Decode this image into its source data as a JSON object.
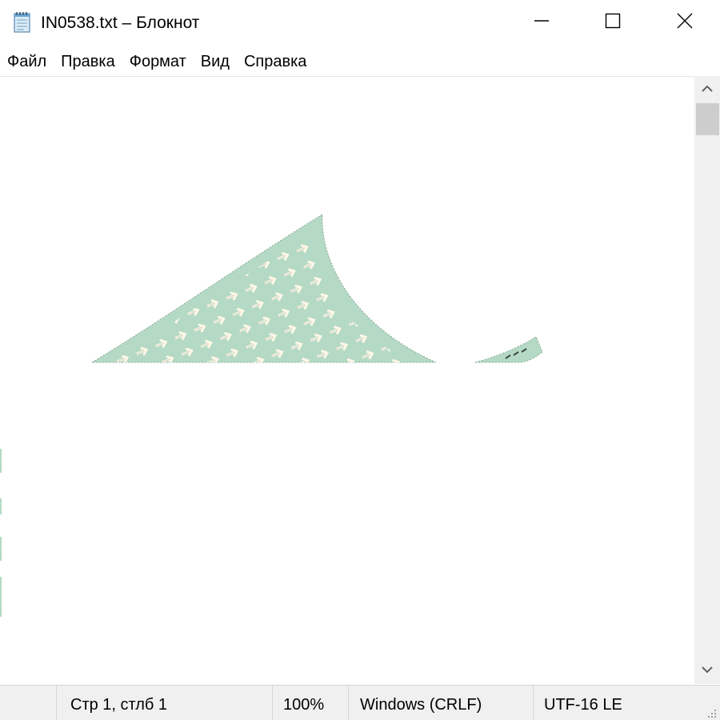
{
  "window": {
    "title": "IN0538.txt – Блокнот",
    "app_icon": "notepad-icon",
    "controls": {
      "minimize_icon": "minimize-icon",
      "maximize_icon": "maximize-icon",
      "close_icon": "close-icon"
    }
  },
  "menu": {
    "items": [
      {
        "label": "Файл"
      },
      {
        "label": "Правка"
      },
      {
        "label": "Формат"
      },
      {
        "label": "Вид"
      },
      {
        "label": "Справка"
      }
    ]
  },
  "editor": {
    "content_text": "",
    "artifact_fill": "#b4d9c4",
    "artifact_glyph_color": "#fdf7e6"
  },
  "scrollbar": {
    "up_icon": "chevron-up-icon",
    "down_icon": "chevron-down-icon"
  },
  "status": {
    "position": "Стр 1, стлб 1",
    "zoom": "100%",
    "line_endings": "Windows (CRLF)",
    "encoding": "UTF-16 LE"
  },
  "colors": {
    "chrome_bg": "#f0f0f0",
    "text": "#000000",
    "scroll_thumb": "#cdcdcd"
  }
}
